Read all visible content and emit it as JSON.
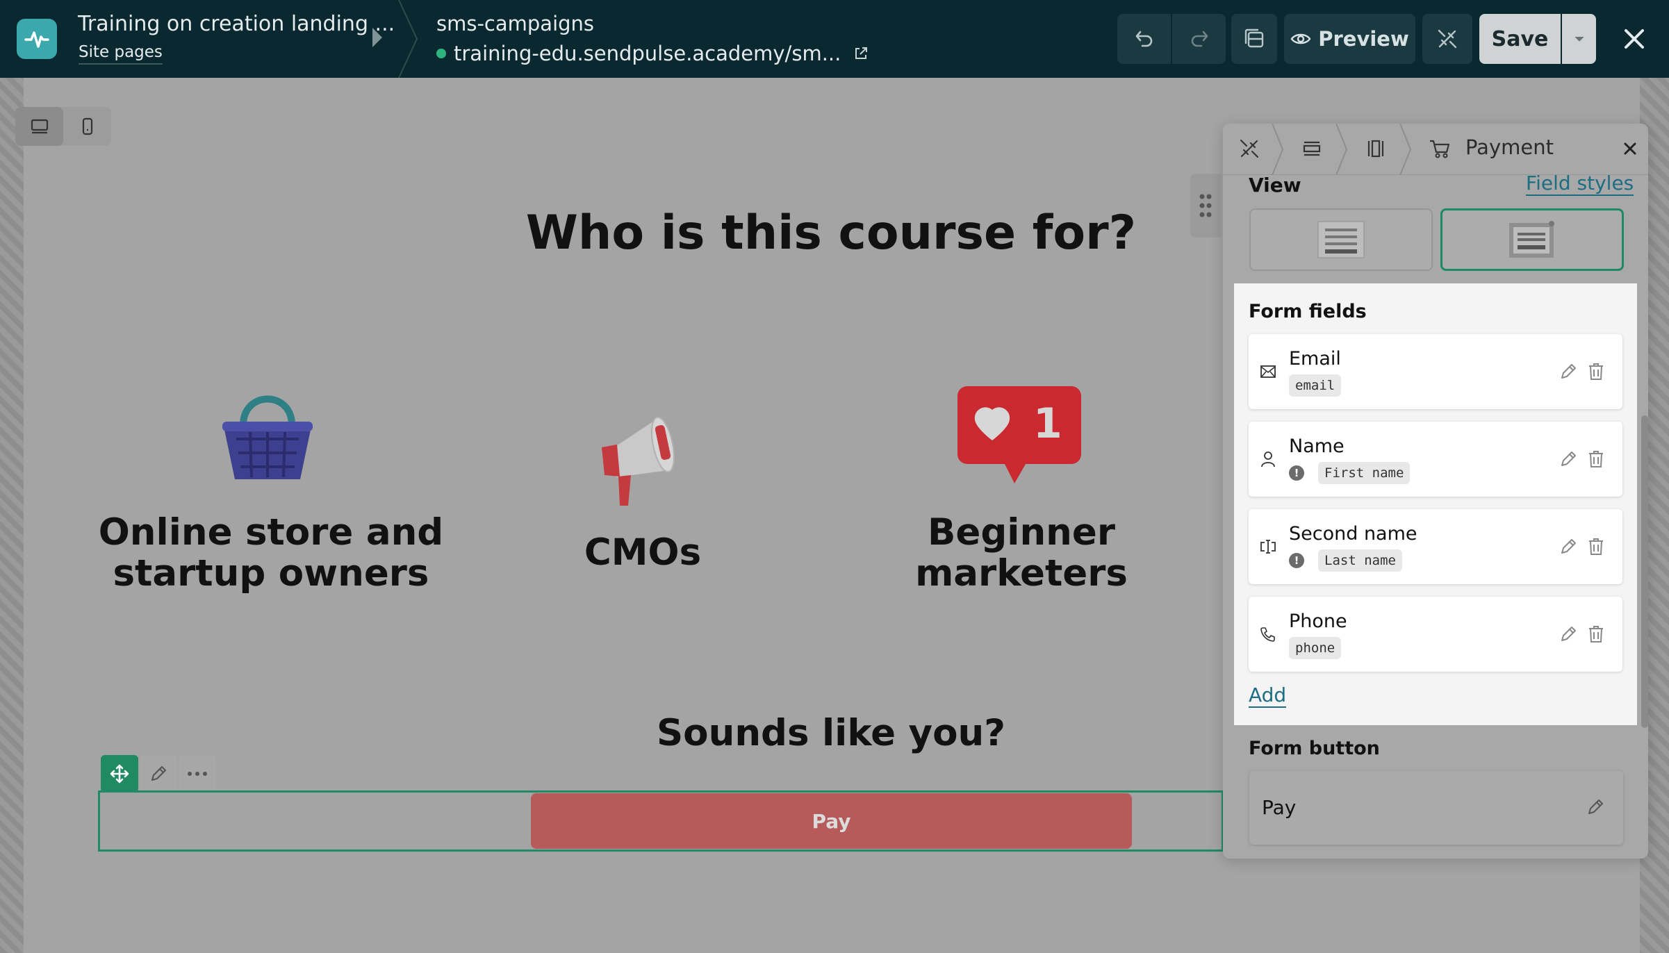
{
  "header": {
    "project_title": "Training on creation landing ...",
    "site_pages_link": "Site pages",
    "page_name": "sms-campaigns",
    "page_url": "training-edu.sendpulse.academy/sm...",
    "preview_label": "Preview",
    "save_label": "Save"
  },
  "canvas": {
    "heading": "Who is this course for?",
    "audiences": [
      {
        "label_line1": "Online store and",
        "label_line2": "startup owners"
      },
      {
        "label_line1": "CMOs"
      },
      {
        "label_line1": "Beginner",
        "label_line2": "marketers"
      }
    ],
    "subheading": "Sounds like you?",
    "pay_button_label": "Pay"
  },
  "panel": {
    "title": "Payment",
    "view_label": "View",
    "field_styles_link": "Field styles",
    "form_fields_title": "Form fields",
    "fields": [
      {
        "name": "Email",
        "tag": "email",
        "icon": "envelope-icon",
        "warning": false
      },
      {
        "name": "Name",
        "tag": "First name",
        "icon": "person-icon",
        "warning": true
      },
      {
        "name": "Second name",
        "tag": "Last name",
        "icon": "text-cursor-icon",
        "warning": true
      },
      {
        "name": "Phone",
        "tag": "phone",
        "icon": "phone-icon",
        "warning": false
      }
    ],
    "add_link": "Add",
    "form_button_title": "Form button",
    "form_button_label": "Pay"
  },
  "colors": {
    "topbar": "#0a2830",
    "accent_green": "#1f8a63",
    "link_blue": "#1d6d83",
    "pay_button": "#b65a5a"
  }
}
